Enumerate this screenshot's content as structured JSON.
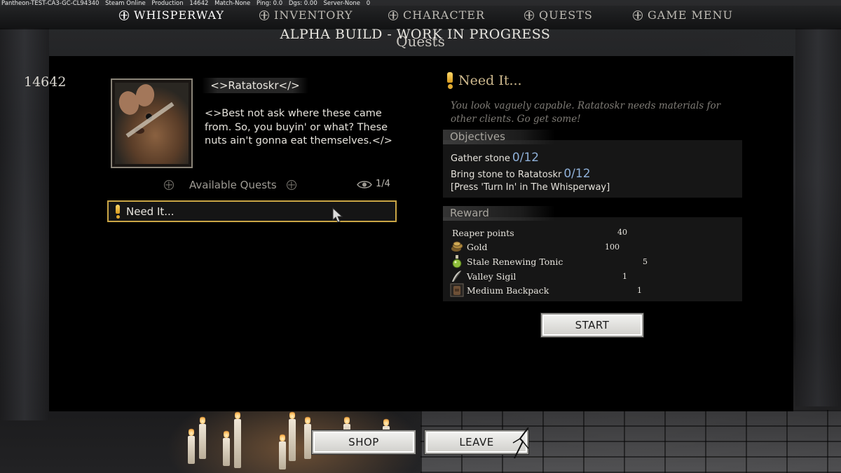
{
  "debug": {
    "build": "Pantheon-TEST-CA3-GC-CL94340",
    "steam": "Steam Online",
    "env": "Production",
    "id": "14642",
    "match": "Match-None",
    "ping": "Ping: 0.0",
    "dgs": "Dgs: 0.00",
    "server": "Server-None",
    "extra": "0"
  },
  "nav": {
    "items": [
      {
        "label": "WHISPERWAY",
        "active": true
      },
      {
        "label": "INVENTORY",
        "active": false
      },
      {
        "label": "CHARACTER",
        "active": false
      },
      {
        "label": "QUESTS",
        "active": false
      },
      {
        "label": "GAME MENU",
        "active": false
      }
    ]
  },
  "banner": "ALPHA BUILD - WORK IN PROGRESS",
  "window_title": "Quests",
  "currency": "14642",
  "npc": {
    "name": "<>Ratatoskr</>",
    "dialogue": "<>Best not ask where these came from. So, you buyin' or what? These nuts ain't gonna eat themselves.</>"
  },
  "available": {
    "label": "Available Quests",
    "count": "1/4",
    "quests": [
      {
        "label": "Need It..."
      }
    ]
  },
  "detail": {
    "title": "Need It...",
    "description": "You look vaguely capable. Ratatoskr needs materials for other clients. Go get some!",
    "objectives_label": "Objectives",
    "objectives": [
      {
        "text": "Gather stone",
        "progress": "0/12"
      },
      {
        "text": "Bring stone to Ratatoskr",
        "progress": "0/12"
      }
    ],
    "objective_note": "[Press 'Turn In' in The Whisperway]",
    "reward_label": "Reward",
    "rewards": [
      {
        "name": "Reaper points",
        "qty": "40",
        "icon": "none"
      },
      {
        "name": "Gold",
        "qty": "100",
        "icon": "gold-coins-icon"
      },
      {
        "name": "Stale Renewing Tonic",
        "qty": "5",
        "icon": "potion-icon"
      },
      {
        "name": "Valley Sigil",
        "qty": "1",
        "icon": "feather-sigil-icon"
      },
      {
        "name": "Medium Backpack",
        "qty": "1",
        "icon": "backpack-icon"
      }
    ],
    "start_label": "START"
  },
  "footer": {
    "shop_label": "SHOP",
    "leave_label": "LEAVE"
  },
  "colors": {
    "accent_gold": "#c9a545",
    "progress_blue": "#8fb0d8",
    "title_tan": "#cdb88d"
  }
}
